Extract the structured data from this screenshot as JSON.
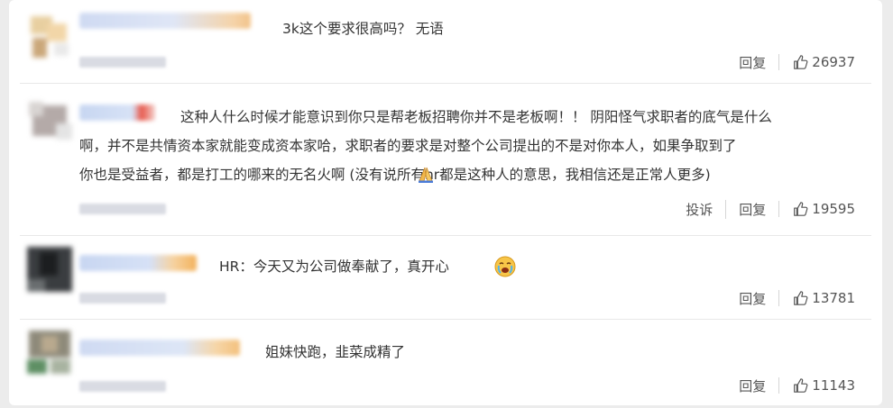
{
  "comments": [
    {
      "text_lines": [
        "3k这个要求很高吗？ 无语"
      ],
      "actions": {
        "reply_label": "回复"
      },
      "likes": "26937"
    },
    {
      "text_lines": [
        "这种人什么时候才能意识到你只是帮老板招聘你并不是老板啊！！ 阴阳怪气求职者的底气是什么",
        "啊，并不是共情资本家就能变成资本家哈，求职者的要求是对整个公司提出的不是对你本人，如果争取到了",
        "你也是受益者，都是打工的哪来的无名火啊 (没有说所有hr都是这种人的意思，我相信还是正常人更多)"
      ],
      "emoji": "pray-hands",
      "actions": {
        "report_label": "投诉",
        "reply_label": "回复"
      },
      "likes": "19595"
    },
    {
      "text_lines": [
        "HR：今天又为公司做奉献了，真开心"
      ],
      "emoji": "crying-face",
      "actions": {
        "reply_label": "回复"
      },
      "likes": "13781"
    },
    {
      "text_lines": [
        "姐妹快跑，韭菜成精了"
      ],
      "actions": {
        "reply_label": "回复"
      },
      "likes": "11143"
    }
  ],
  "colors": {
    "accent_blue": "#6a8fd8",
    "text": "#333333",
    "muted": "#555555"
  },
  "icons": {
    "like": "thumbs-up-icon"
  }
}
